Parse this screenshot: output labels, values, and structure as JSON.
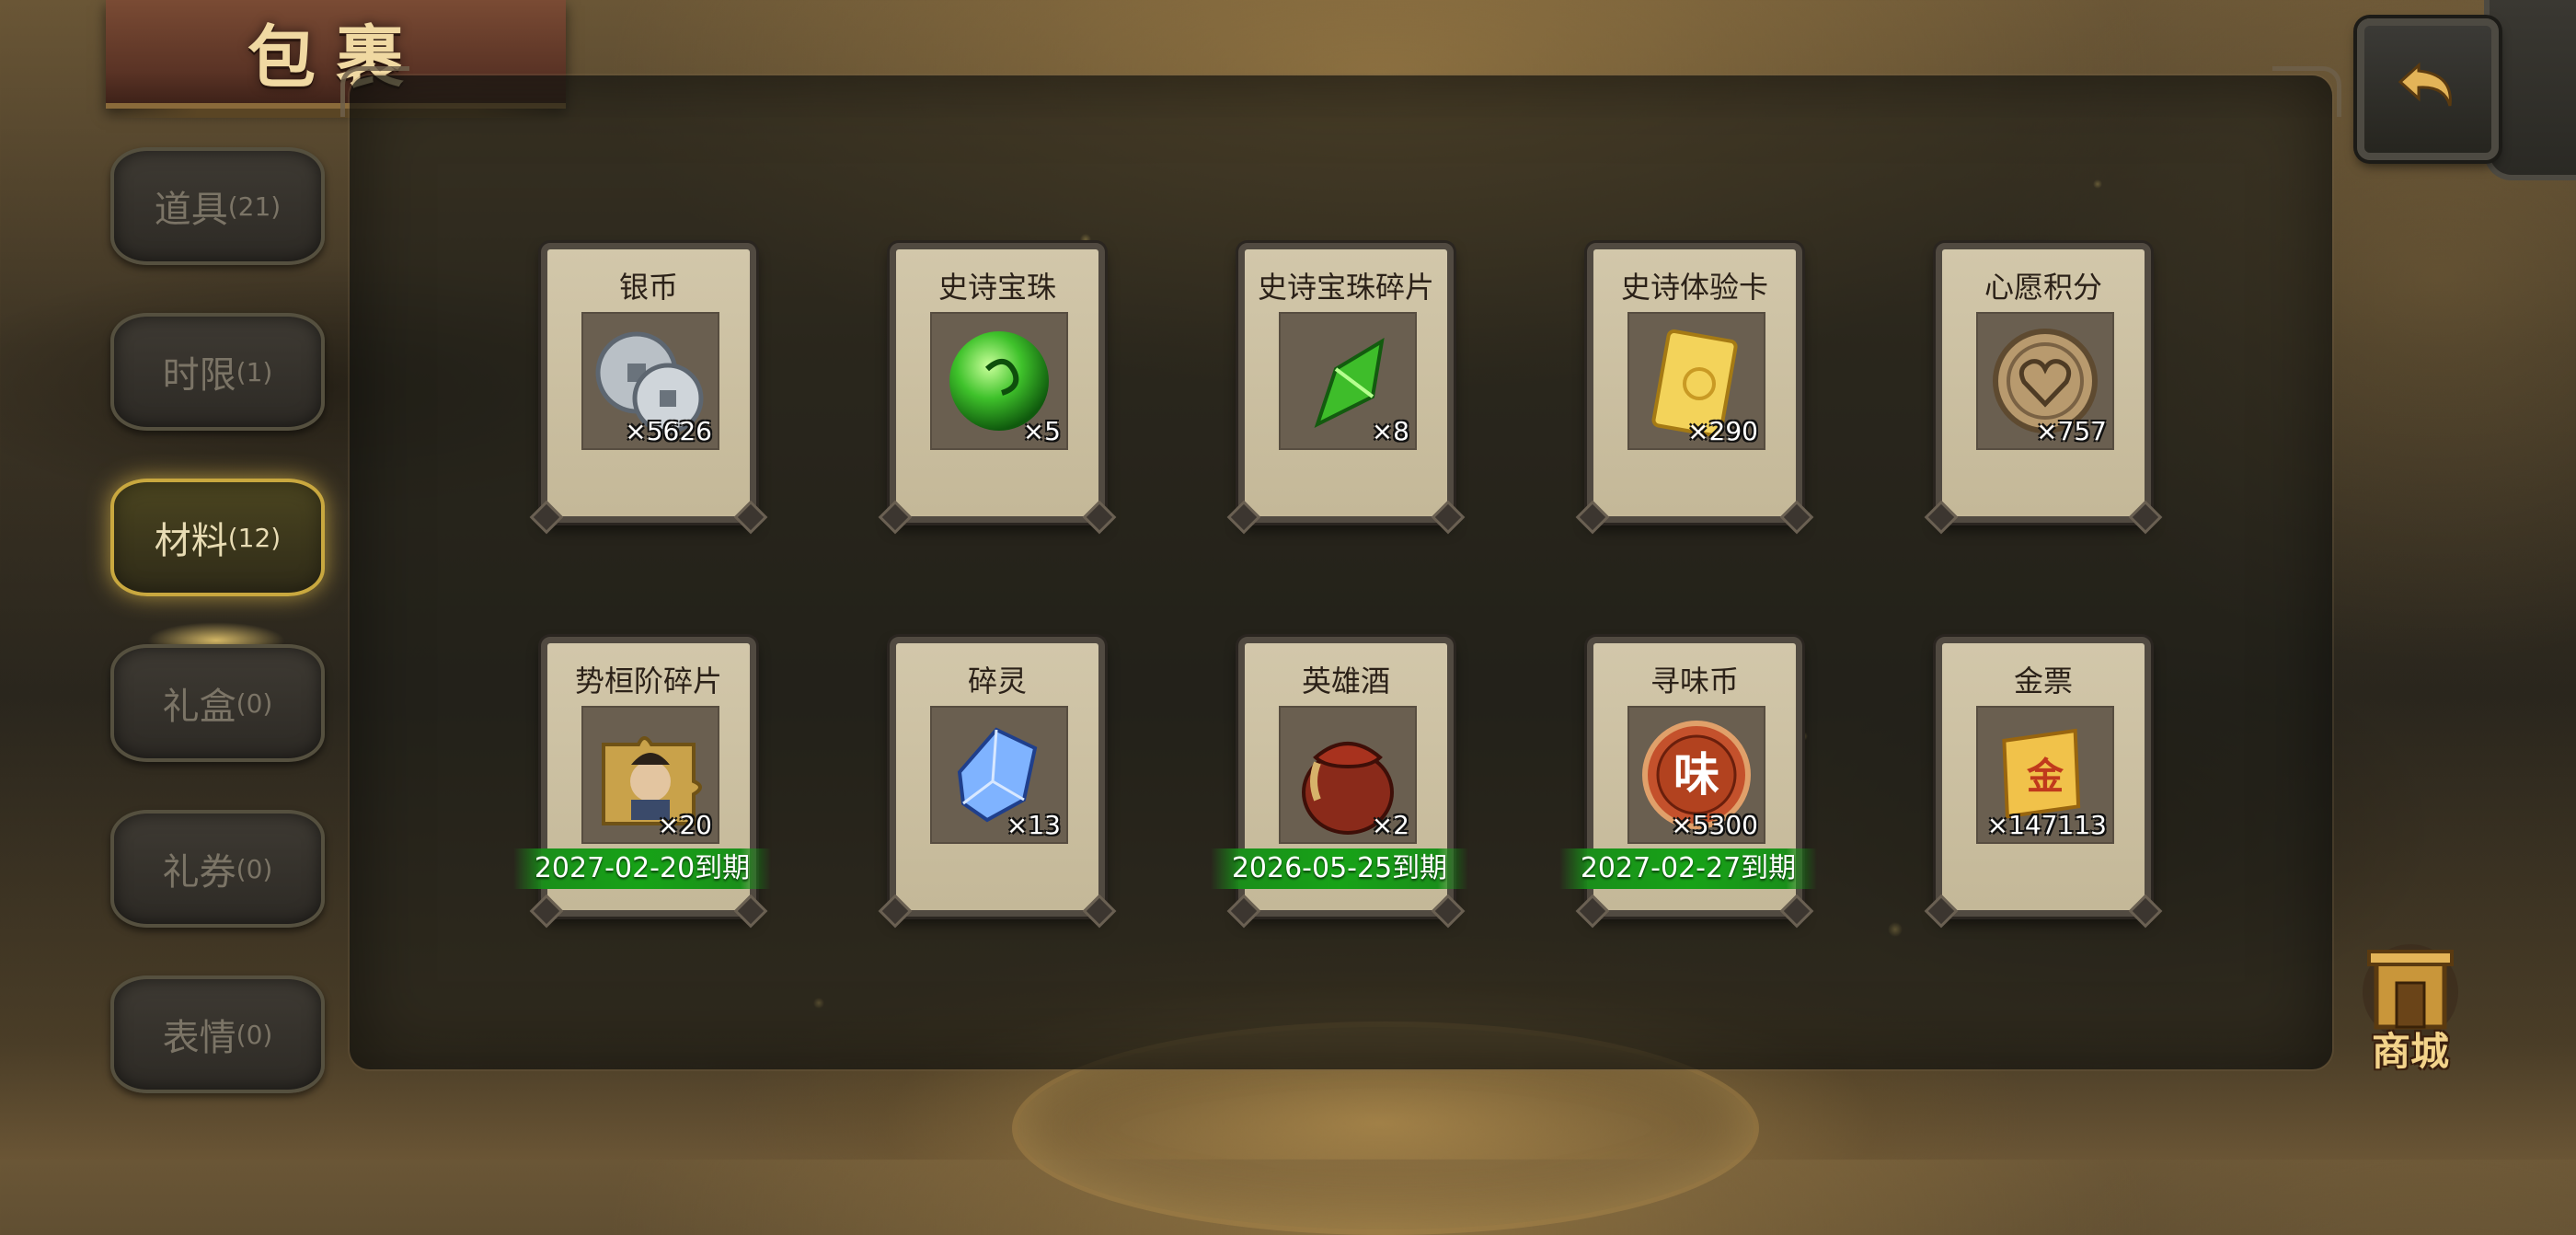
{
  "title": "包裹",
  "tabs": [
    {
      "label": "道具",
      "count": "(21)",
      "active": false
    },
    {
      "label": "时限",
      "count": "(1)",
      "active": false
    },
    {
      "label": "材料",
      "count": "(12)",
      "active": true
    },
    {
      "label": "礼盒",
      "count": "(0)",
      "active": false
    },
    {
      "label": "礼券",
      "count": "(0)",
      "active": false
    },
    {
      "label": "表情",
      "count": "(0)",
      "active": false
    }
  ],
  "items": [
    {
      "name": "银币",
      "qty": "×5626",
      "icon": "silver-coins-icon",
      "expiry": ""
    },
    {
      "name": "史诗宝珠",
      "qty": "×5",
      "icon": "green-orb-icon",
      "expiry": ""
    },
    {
      "name": "史诗宝珠碎片",
      "qty": "×8",
      "icon": "green-shard-icon",
      "expiry": ""
    },
    {
      "name": "史诗体验卡",
      "qty": "×290",
      "icon": "gold-card-icon",
      "expiry": ""
    },
    {
      "name": "心愿积分",
      "qty": "×757",
      "icon": "heart-coin-icon",
      "expiry": ""
    },
    {
      "name": "势桓阶碎片",
      "qty": "×20",
      "icon": "portrait-puzzle-icon",
      "expiry": "2027-02-20到期"
    },
    {
      "name": "碎灵",
      "qty": "×13",
      "icon": "blue-crystal-icon",
      "expiry": ""
    },
    {
      "name": "英雄酒",
      "qty": "×2",
      "icon": "wine-jar-icon",
      "expiry": "2026-05-25到期"
    },
    {
      "name": "寻味币",
      "qty": "×5300",
      "icon": "flavor-coin-icon",
      "expiry": "2027-02-27到期"
    },
    {
      "name": "金票",
      "qty": "×147113",
      "icon": "gold-scroll-icon",
      "expiry": ""
    }
  ],
  "flavor_coin_glyph": "味",
  "gold_scroll_glyph": "金",
  "shop_label": "商城",
  "colors": {
    "expiry_green": "#17a317",
    "active_tab_glow": "#c9a83f",
    "card_bg": "#d2c7aa"
  }
}
